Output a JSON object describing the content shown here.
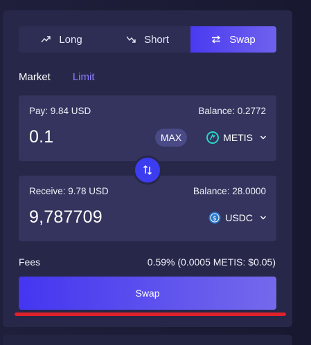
{
  "tabs": [
    {
      "label": "Long",
      "icon": "trend-up-icon",
      "active": false
    },
    {
      "label": "Short",
      "icon": "trend-down-icon",
      "active": false
    },
    {
      "label": "Swap",
      "icon": "swap-arrows-icon",
      "active": true
    }
  ],
  "order_types": [
    {
      "label": "Market",
      "active": true
    },
    {
      "label": "Limit",
      "active": false
    }
  ],
  "pay": {
    "label": "Pay: 9.84 USD",
    "balance": "Balance: 0.2772",
    "amount": "0.1",
    "max_label": "MAX",
    "token": "METIS",
    "token_icon": "metis-token-icon"
  },
  "receive": {
    "label": "Receive: 9.78 USD",
    "balance": "Balance: 28.0000",
    "amount": "9,787709",
    "token": "USDC",
    "token_icon": "usdc-token-icon"
  },
  "fees": {
    "label": "Fees",
    "value": "0.59%  (0.0005 METIS: $0.05)"
  },
  "submit": {
    "label": "Swap"
  },
  "colors": {
    "accent": "#4a3af0",
    "limit_text": "#8d7fff",
    "underline": "#e0202a"
  }
}
